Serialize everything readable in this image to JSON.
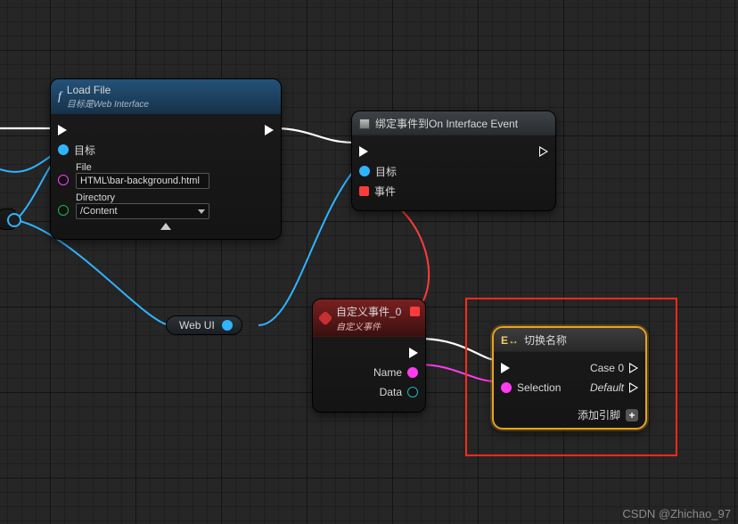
{
  "nodes": {
    "load_file": {
      "title": "Load File",
      "subtitle": "目标是Web Interface",
      "pins": {
        "target": "目标",
        "file_label": "File",
        "file_value": "HTML\\bar-background.html",
        "directory_label": "Directory",
        "directory_value": "/Content"
      }
    },
    "bind_event": {
      "title": "绑定事件到On Interface Event",
      "pins": {
        "target": "目标",
        "event": "事件"
      }
    },
    "custom_event": {
      "title": "自定义事件_0",
      "subtitle": "自定义事件",
      "pins": {
        "name": "Name",
        "data": "Data"
      }
    },
    "switch": {
      "title": "切换名称",
      "pins": {
        "selection": "Selection",
        "case0": "Case 0",
        "default": "Default",
        "add_pin": "添加引脚"
      }
    }
  },
  "reroutes": {
    "web_ui": "Web UI"
  },
  "watermark": "CSDN @Zhichao_97"
}
